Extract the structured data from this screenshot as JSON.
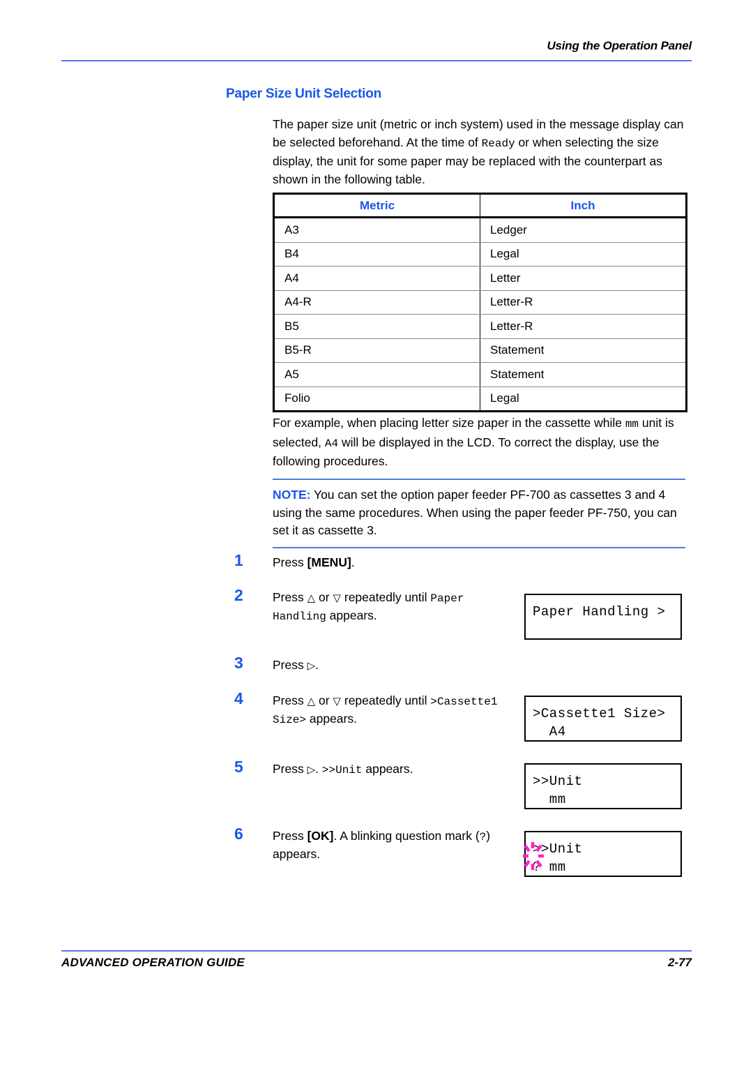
{
  "header": {
    "running_head": "Using the Operation Panel",
    "rule_color": "#4a7be8"
  },
  "section": {
    "title": "Paper Size Unit Selection",
    "title_color": "#1a57e8"
  },
  "intro_paragraph": {
    "part1": "The paper size unit (metric or inch system) used in the message display can be selected beforehand. At the time of ",
    "mono1": "Ready",
    "part2": " or when selecting the size display, the unit for some paper may be replaced with the counterpart as shown in the following table."
  },
  "table": {
    "headers": [
      "Metric",
      "Inch"
    ],
    "header_color": "#1a57e8",
    "rows": [
      [
        "A3",
        "Ledger"
      ],
      [
        "B4",
        "Legal"
      ],
      [
        "A4",
        "Letter"
      ],
      [
        "A4-R",
        "Letter-R"
      ],
      [
        "B5",
        "Letter-R"
      ],
      [
        "B5-R",
        "Statement"
      ],
      [
        "A5",
        "Statement"
      ],
      [
        "Folio",
        "Legal"
      ]
    ]
  },
  "example_paragraph": {
    "part1": "For example, when placing letter size paper in the cassette while ",
    "mono1": "mm",
    "part2": " unit is selected, ",
    "mono2": "A4",
    "part3": " will be displayed in the LCD. To correct the display, use the following procedures."
  },
  "note": {
    "label": "NOTE:",
    "text": " You can set the option paper feeder PF-700 as cassettes 3 and 4 using the same procedures. When using the paper feeder PF-750, you can set it as cassette 3.",
    "rule_color": "#4a7be8"
  },
  "steps": [
    {
      "number": "1",
      "text_part1": "Press ",
      "bold1": "[MENU]",
      "text_part2": ".",
      "lcd": null
    },
    {
      "number": "2",
      "text_part1": "Press ",
      "glyph_up": "△",
      "text_mid": " or ",
      "glyph_down": "▽",
      "text_part2": " repeatedly until ",
      "mono1": "Paper Handling",
      "text_part3": " appears.",
      "lcd": {
        "line1": "Paper Handling >",
        "line2": ""
      }
    },
    {
      "number": "3",
      "text_part1": "Press ",
      "glyph_right": "▷",
      "text_part2": ".",
      "lcd": null
    },
    {
      "number": "4",
      "text_part1": "Press ",
      "glyph_up": "△",
      "text_mid": " or ",
      "glyph_down": "▽",
      "text_part2": " repeatedly until ",
      "mono1": ">Cassette1 Size>",
      "text_part3": " appears.",
      "lcd": {
        "line1": ">Cassette1 Size>",
        "line2": "  A4"
      }
    },
    {
      "number": "5",
      "text_part1": "Press ",
      "glyph_right": "▷",
      "text_part2": ". ",
      "mono1": ">>Unit",
      "text_part3": " appears.",
      "lcd": {
        "line1": ">>Unit",
        "line2": "  mm"
      }
    },
    {
      "number": "6",
      "text_part1": "Press ",
      "bold1": "[OK]",
      "text_part2": ". A blinking question mark (",
      "mono1": "?",
      "text_part3": ") appears.",
      "lcd": {
        "line1": ">>Unit",
        "line2": "? mm",
        "blink": true,
        "blink_color": "#ff22cc"
      }
    }
  ],
  "footer": {
    "guide": "ADVANCED OPERATION GUIDE",
    "page": "2-77",
    "rule_color": "#4a7be8"
  }
}
